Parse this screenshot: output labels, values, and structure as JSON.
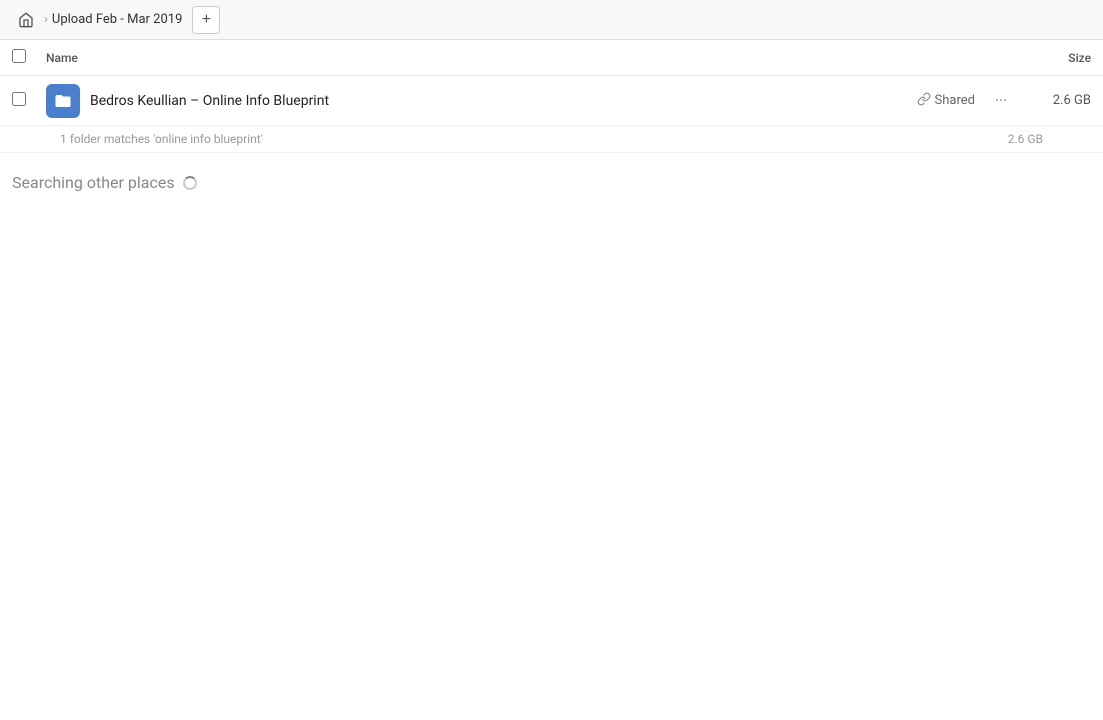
{
  "topbar": {
    "home_title": "Home",
    "breadcrumb_title": "Upload Feb - Mar 2019",
    "add_button_label": "+"
  },
  "column_headers": {
    "name_label": "Name",
    "size_label": "Size"
  },
  "file_row": {
    "name": "Bedros Keullian – Online Info Blueprint",
    "shared_label": "Shared",
    "size": "2.6 GB",
    "icon_color": "#4a7fcb"
  },
  "match_info": {
    "text": "1 folder matches 'online info blueprint'",
    "size": "2.6 GB"
  },
  "search_status": {
    "text": "Searching other places"
  }
}
